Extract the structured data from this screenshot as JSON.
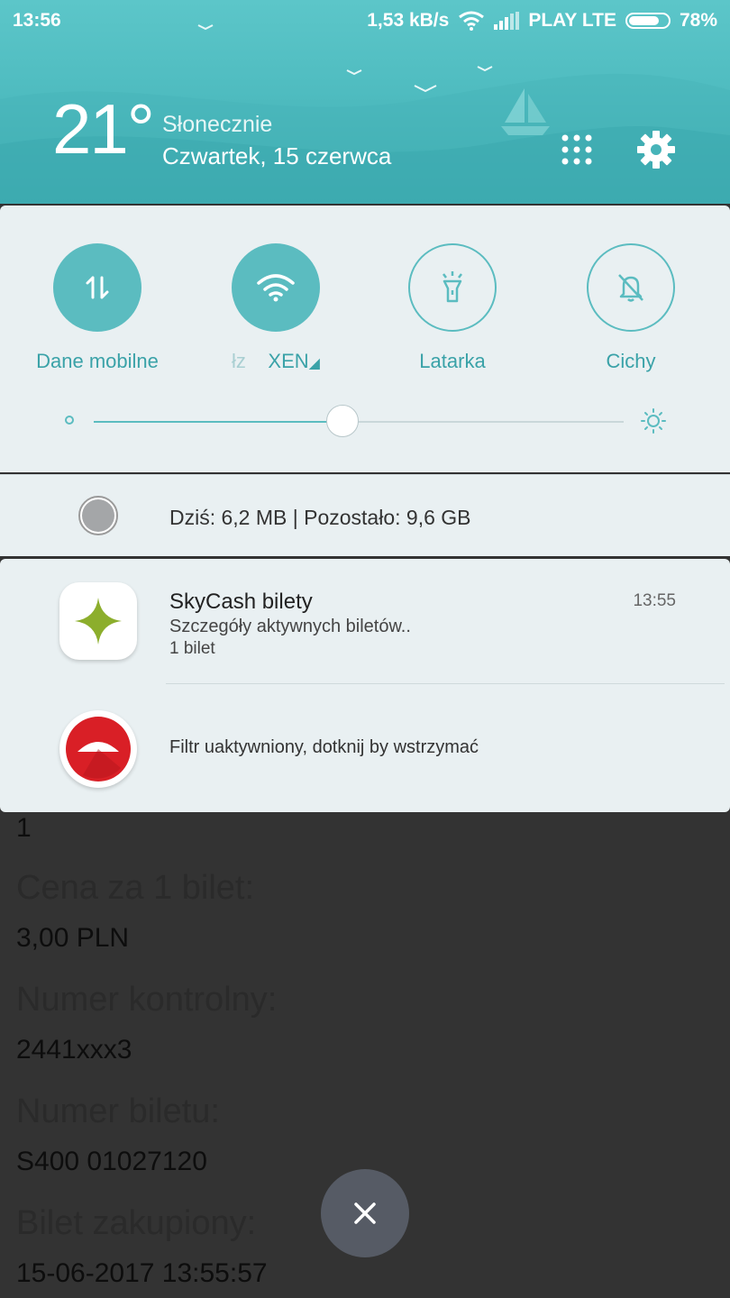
{
  "status_bar": {
    "time": "13:56",
    "speed": "1,53 kB/s",
    "carrier": "PLAY LTE",
    "battery": "78%",
    "battery_level": 0.78
  },
  "weather": {
    "temperature": "21°",
    "condition": "Słonecznie",
    "date": "Czwartek, 15 czerwca"
  },
  "quick_settings": {
    "toggles": [
      {
        "label": "Dane mobilne",
        "icon": "mobile-data-icon",
        "state": "on"
      },
      {
        "label_faint": "łz",
        "label": "XEN",
        "icon": "wifi-icon",
        "state": "on"
      },
      {
        "label": "Latarka",
        "icon": "flashlight-icon",
        "state": "off"
      },
      {
        "label": "Cichy",
        "icon": "bell-off-icon",
        "state": "off"
      }
    ],
    "brightness_level": 0.47
  },
  "data_usage": {
    "text": "Dziś: 6,2 MB | Pozostało: 9,6 GB"
  },
  "notifications": [
    {
      "app": "SkyCash bilety",
      "time": "13:55",
      "line1": "Szczegóły aktywnych biletów..",
      "line2": "1 bilet"
    },
    {
      "text": "Filtr uaktywniony, dotknij by wstrzymać"
    }
  ],
  "background_app": {
    "items": [
      {
        "value": "1"
      },
      {
        "label": "Cena za 1 bilet:",
        "value": "3,00 PLN"
      },
      {
        "label": "Numer kontrolny:",
        "value": "2441xxx3"
      },
      {
        "label": "Numer biletu:",
        "value": "S400 01027120"
      },
      {
        "label": "Bilet zakupiony:",
        "value": "15-06-2017 13:55:57"
      }
    ]
  },
  "colors": {
    "accent": "#5bbcc0",
    "panel": "#e9f0f2",
    "scrim": "#333333"
  }
}
